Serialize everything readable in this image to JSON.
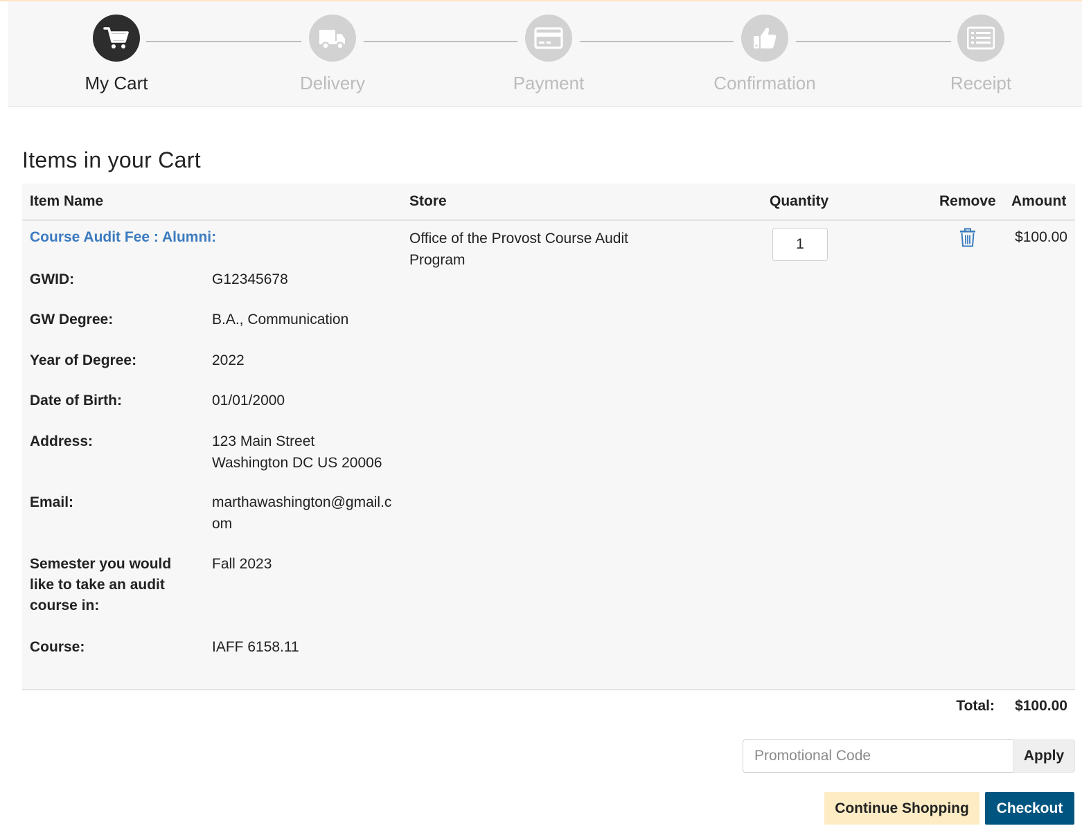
{
  "steps": [
    {
      "label": "My Cart",
      "icon": "cart-icon",
      "active": true
    },
    {
      "label": "Delivery",
      "icon": "truck-icon",
      "active": false
    },
    {
      "label": "Payment",
      "icon": "credit-card-icon",
      "active": false
    },
    {
      "label": "Confirmation",
      "icon": "thumbs-up-icon",
      "active": false
    },
    {
      "label": "Receipt",
      "icon": "list-icon",
      "active": false
    }
  ],
  "page_title": "Items in your Cart",
  "table": {
    "headers": {
      "item_name": "Item Name",
      "store": "Store",
      "quantity": "Quantity",
      "remove": "Remove",
      "amount": "Amount"
    },
    "item": {
      "name": "Course Audit Fee : Alumni:",
      "store": "Office of the Provost Course Audit Program",
      "quantity": "1",
      "amount": "$100.00",
      "remove_icon": "trash-icon",
      "details": [
        {
          "label": "GWID:",
          "value": "G12345678"
        },
        {
          "label": "GW Degree:",
          "value": "B.A., Communication"
        },
        {
          "label": "Year of Degree:",
          "value": "2022"
        },
        {
          "label": "Date of Birth:",
          "value": "01/01/2000"
        },
        {
          "label": "Address:",
          "value": "123 Main Street\nWashington DC US 20006"
        },
        {
          "label": "Email:",
          "value": "marthawashington@gmail.com"
        },
        {
          "label": "Semester you would like to take an audit course in:",
          "value": "Fall 2023"
        },
        {
          "label": "Course:",
          "value": "IAFF 6158.11"
        }
      ]
    }
  },
  "total": {
    "label": "Total:",
    "value": "$100.00"
  },
  "promo": {
    "placeholder": "Promotional Code",
    "button_label": "Apply"
  },
  "actions": {
    "continue_label": "Continue Shopping",
    "checkout_label": "Checkout"
  },
  "colors": {
    "link": "#3b7bbf",
    "checkout": "#005580",
    "continue": "#fdecc4",
    "step_active": "#2d2d2d",
    "step_inactive": "#d2d2d2"
  }
}
